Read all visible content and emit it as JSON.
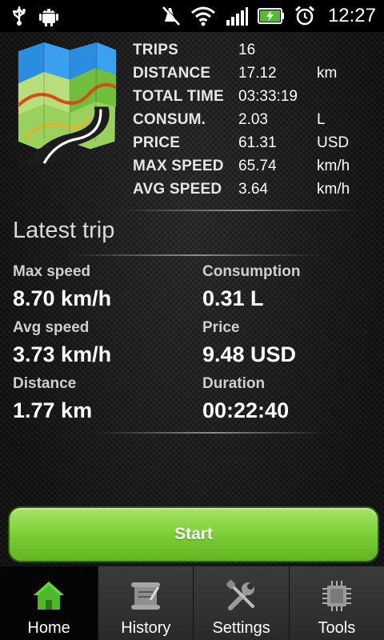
{
  "status_bar": {
    "time": "12:27",
    "icons": [
      "usb-icon",
      "android-debug-icon",
      "mute-icon",
      "wifi-icon",
      "signal-icon",
      "battery-charging-icon",
      "alarm-icon"
    ]
  },
  "summary": {
    "rows": [
      {
        "label": "TRIPS",
        "value": "16",
        "unit": ""
      },
      {
        "label": "DISTANCE",
        "value": "17.12",
        "unit": "km"
      },
      {
        "label": "TOTAL TIME",
        "value": "03:33:19",
        "unit": ""
      },
      {
        "label": "CONSUM.",
        "value": "2.03",
        "unit": "L"
      },
      {
        "label": "PRICE",
        "value": "61.31",
        "unit": "USD"
      },
      {
        "label": "MAX SPEED",
        "value": "65.74",
        "unit": "km/h"
      },
      {
        "label": "AVG SPEED",
        "value": "3.64",
        "unit": "km/h"
      }
    ]
  },
  "latest_trip": {
    "title": "Latest trip",
    "max_speed": {
      "label": "Max speed",
      "value": "8.70 km/h"
    },
    "avg_speed": {
      "label": "Avg speed",
      "value": "3.73 km/h"
    },
    "distance": {
      "label": "Distance",
      "value": "1.77 km"
    },
    "consumption": {
      "label": "Consumption",
      "value": "0.31 L"
    },
    "price": {
      "label": "Price",
      "value": "9.48 USD"
    },
    "duration": {
      "label": "Duration",
      "value": "00:22:40"
    }
  },
  "start_button": {
    "label": "Start"
  },
  "tabs": [
    {
      "label": "Home",
      "icon": "home-icon",
      "active": true
    },
    {
      "label": "History",
      "icon": "history-scroll-icon",
      "active": false
    },
    {
      "label": "Settings",
      "icon": "wrench-screwdriver-icon",
      "active": false
    },
    {
      "label": "Tools",
      "icon": "chip-icon",
      "active": false
    }
  ],
  "colors": {
    "accent_green": "#7fd13a",
    "active_tab_icon": "#4db82a",
    "inactive_tab_icon": "#8f8f8f"
  }
}
